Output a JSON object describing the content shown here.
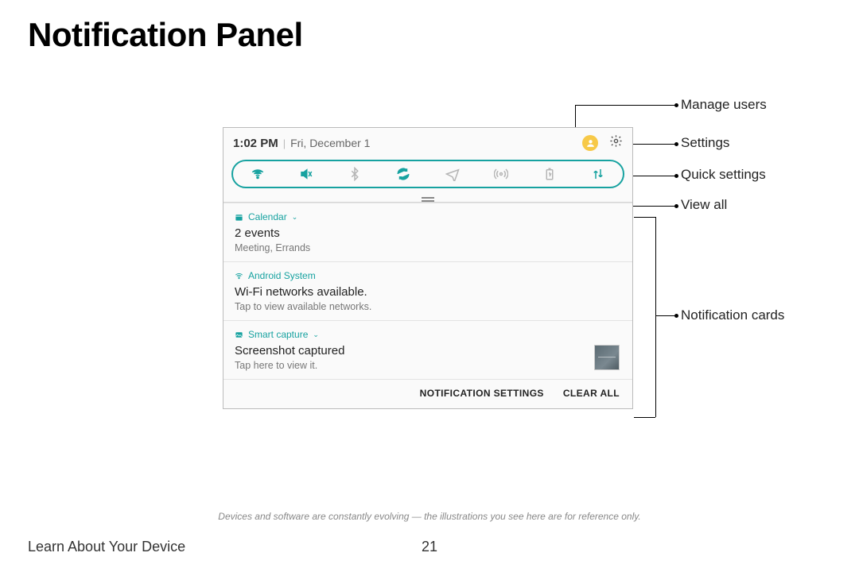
{
  "page": {
    "title": "Notification Panel",
    "disclaimer": "Devices and software are constantly evolving — the illustrations you see here are for reference only.",
    "section": "Learn About Your Device",
    "number": "21"
  },
  "callouts": {
    "manage": "Manage users",
    "settings": "Settings",
    "quick": "Quick settings",
    "viewall": "View all",
    "cards": "Notification cards"
  },
  "status": {
    "time": "1:02 PM",
    "date": "Fri, December 1"
  },
  "cards": [
    {
      "app": "Calendar",
      "title": "2 events",
      "sub": "Meeting, Errands"
    },
    {
      "app": "Android System",
      "title": "Wi-Fi networks available.",
      "sub": "Tap to view available networks."
    },
    {
      "app": "Smart capture",
      "title": "Screenshot captured",
      "sub": "Tap here to view it."
    }
  ],
  "footer": {
    "settings": "NOTIFICATION SETTINGS",
    "clear": "CLEAR ALL"
  }
}
